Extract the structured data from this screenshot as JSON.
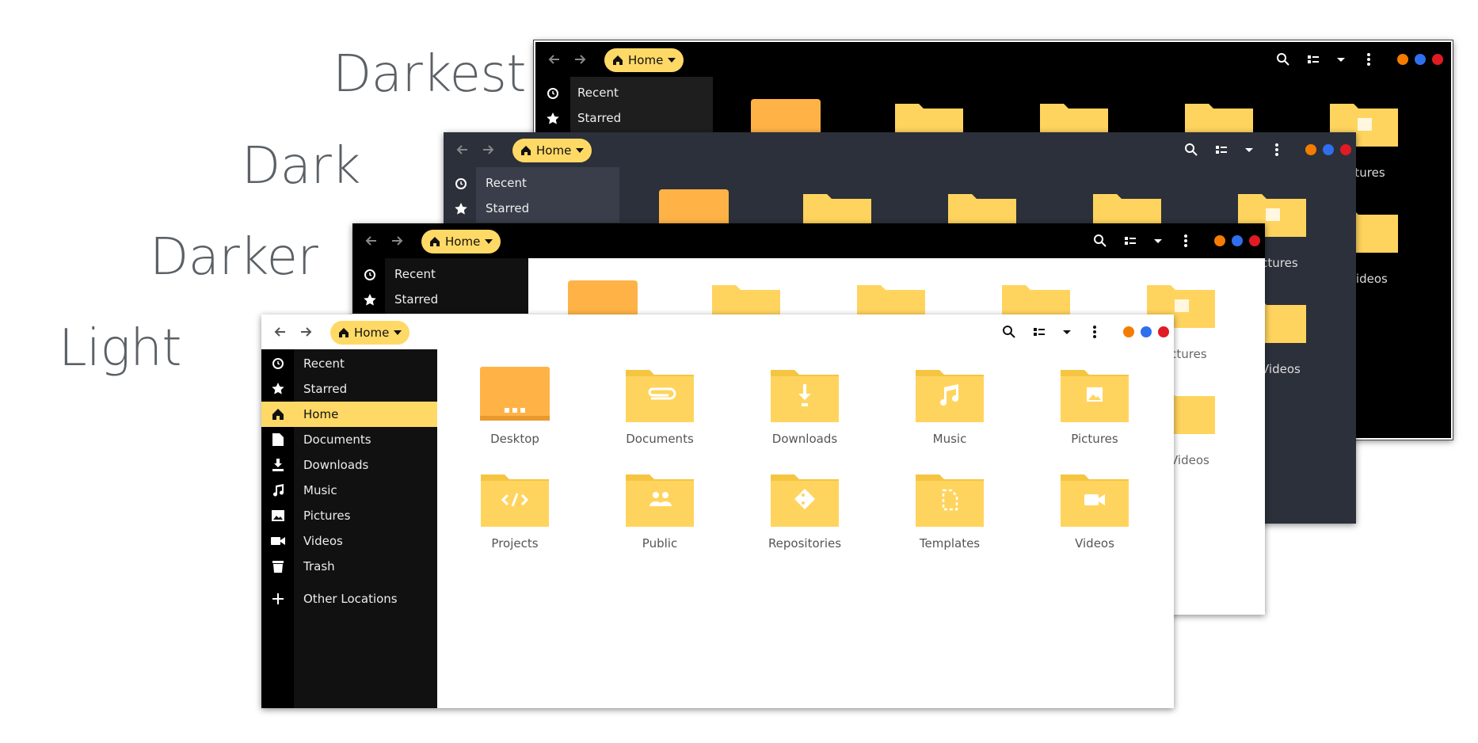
{
  "themes": {
    "darkest": "Darkest",
    "dark": "Dark",
    "darker": "Darker",
    "light": "Light"
  },
  "window": {
    "home_label": "Home",
    "window_controls": [
      "orange",
      "blue",
      "red"
    ]
  },
  "sidebar": {
    "items": [
      {
        "label": "Recent",
        "icon": "clock-icon"
      },
      {
        "label": "Starred",
        "icon": "star-icon"
      },
      {
        "label": "Home",
        "icon": "home-icon",
        "active": true
      },
      {
        "label": "Documents",
        "icon": "document-icon"
      },
      {
        "label": "Downloads",
        "icon": "download-icon"
      },
      {
        "label": "Music",
        "icon": "music-icon"
      },
      {
        "label": "Pictures",
        "icon": "picture-icon"
      },
      {
        "label": "Videos",
        "icon": "video-icon"
      },
      {
        "label": "Trash",
        "icon": "trash-icon"
      }
    ],
    "other_locations": "Other Locations"
  },
  "folders": [
    {
      "name": "Desktop",
      "icon": "desktop-folder-icon"
    },
    {
      "name": "Documents",
      "icon": "paperclip-folder-icon"
    },
    {
      "name": "Downloads",
      "icon": "download-folder-icon"
    },
    {
      "name": "Music",
      "icon": "music-folder-icon"
    },
    {
      "name": "Pictures",
      "icon": "picture-folder-icon"
    },
    {
      "name": "Projects",
      "icon": "code-folder-icon"
    },
    {
      "name": "Public",
      "icon": "people-folder-icon"
    },
    {
      "name": "Repositories",
      "icon": "git-folder-icon"
    },
    {
      "name": "Templates",
      "icon": "template-folder-icon"
    },
    {
      "name": "Videos",
      "icon": "video-folder-icon"
    }
  ],
  "partial": {
    "pictures_tail": "ictures",
    "videos_tail": "Videos"
  },
  "colors": {
    "accent": "#ffd966",
    "folder": "#ffd45e",
    "desktop": "#ffb347",
    "dot_orange": "#f57c00",
    "dot_blue": "#2f6fed",
    "dot_red": "#e01b24"
  }
}
